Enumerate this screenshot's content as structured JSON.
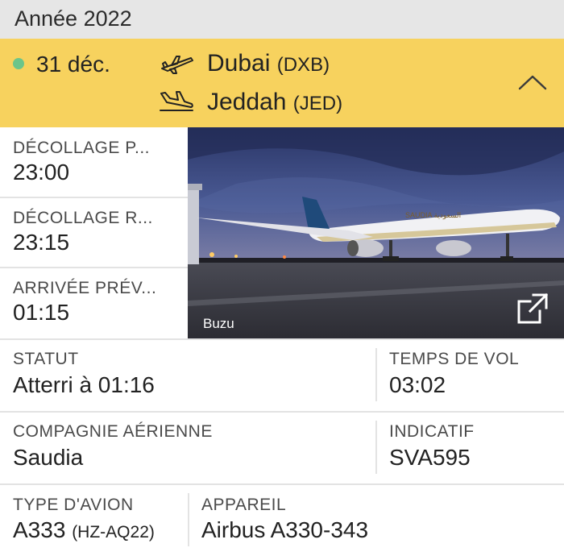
{
  "header": {
    "year": "Année 2022"
  },
  "flight": {
    "date": "31 déc.",
    "status_color": "#6cc58a",
    "origin": {
      "city": "Dubai",
      "code": "(DXB)"
    },
    "destination": {
      "city": "Jeddah",
      "code": "(JED)"
    }
  },
  "times": [
    {
      "label": "DÉCOLLAGE P...",
      "value": "23:00"
    },
    {
      "label": "DÉCOLLAGE R...",
      "value": "23:15"
    },
    {
      "label": "ARRIVÉE PRÉV...",
      "value": "01:15"
    }
  ],
  "photo": {
    "credit": "Buzu",
    "livery_text": "SAUDIA السعودية"
  },
  "details": {
    "status": {
      "label": "STATUT",
      "value": "Atterri à 01:16"
    },
    "flight_time": {
      "label": "TEMPS DE VOL",
      "value": "03:02"
    },
    "airline": {
      "label": "COMPAGNIE AÉRIENNE",
      "value": "Saudia"
    },
    "callsign": {
      "label": "INDICATIF",
      "value": "SVA595"
    },
    "aircraft_type": {
      "label": "TYPE D'AVION",
      "value": "A333",
      "registration": "(HZ-AQ22)"
    },
    "aircraft": {
      "label": "APPAREIL",
      "value": "Airbus A330-343"
    }
  },
  "colors": {
    "accent": "#f7d25e",
    "header_bg": "#e6e6e6",
    "divider": "#e3e3e3"
  }
}
